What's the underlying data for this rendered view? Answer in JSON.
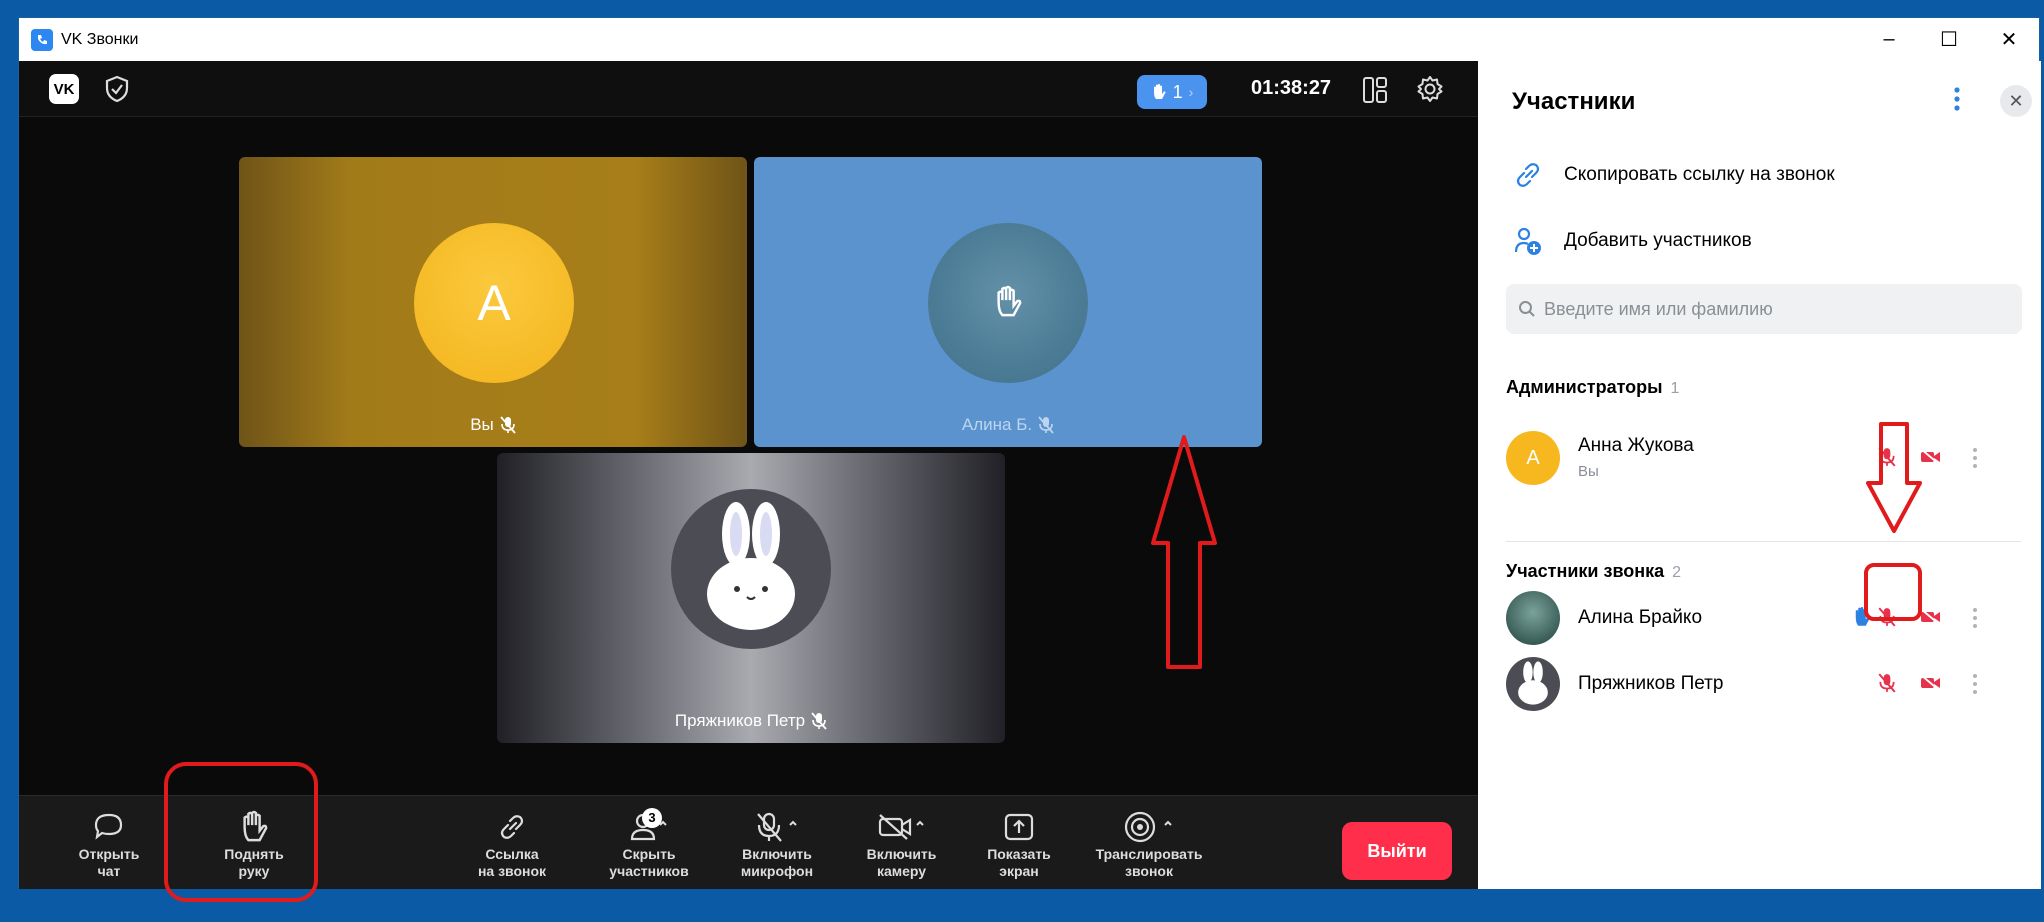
{
  "window": {
    "title": "VK Звонки",
    "min": "–",
    "max": "☐",
    "close": "✕"
  },
  "topbar": {
    "logo": "VK",
    "hand_count": "1",
    "timer": "01:38:27"
  },
  "tiles": {
    "you": {
      "initial": "A",
      "label": "Вы"
    },
    "alina": {
      "label": "Алина Б."
    },
    "petr": {
      "label": "Пряжников Петр"
    }
  },
  "toolbar": {
    "chat": "Открыть\nчат",
    "hand": "Поднять\nруку",
    "link": "Ссылка\nна звонок",
    "hide": "Скрыть\nучастников",
    "hide_badge": "3",
    "mic": "Включить\nмикрофон",
    "camera": "Включить\nкамеру",
    "screen": "Показать\nэкран",
    "stream": "Транслировать\nзвонок",
    "exit": "Выйти"
  },
  "panel": {
    "title": "Участники",
    "copy_link": "Скопировать ссылку на звонок",
    "add_members": "Добавить участников",
    "search_placeholder": "Введите имя или фамилию",
    "admins_title": "Администраторы",
    "admins_count": "1",
    "members_title": "Участники звонка",
    "members_count": "2",
    "admins": [
      {
        "name": "Анна Жукова",
        "sub": "Вы",
        "initial": "A"
      }
    ],
    "members": [
      {
        "name": "Алина Брайко",
        "hand_raised": true
      },
      {
        "name": "Пряжников Петр",
        "hand_raised": false
      }
    ]
  },
  "colors": {
    "accent": "#4a94f0",
    "exit": "#ff2e4a",
    "annotation": "#e11b1b",
    "muted_icon": "#e6324b"
  }
}
